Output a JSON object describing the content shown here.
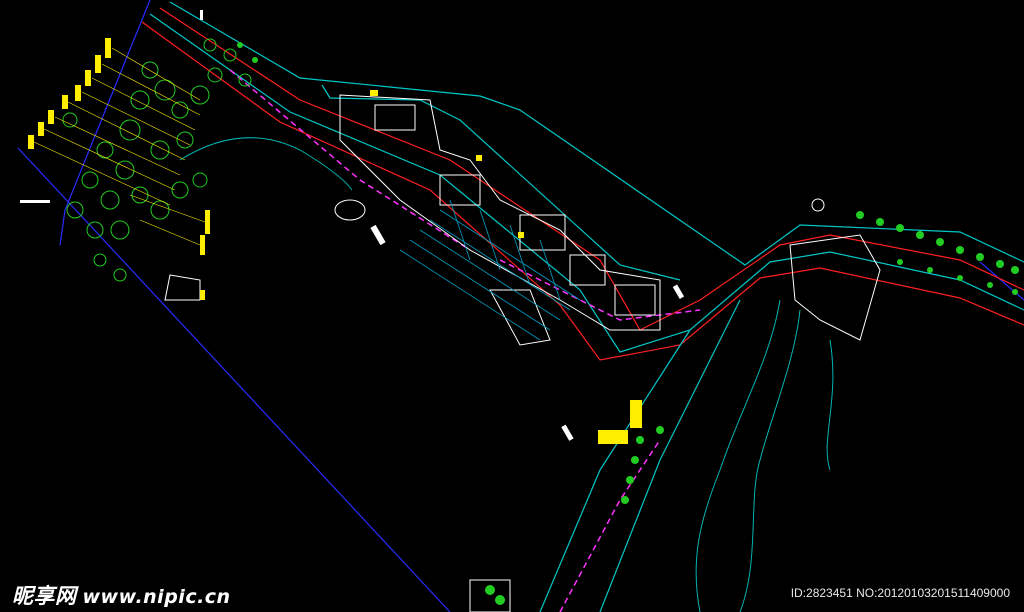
{
  "watermark": {
    "brand_cn": "昵享网",
    "brand_url": "www.nipic.cn",
    "image_id": "ID:2823451 NO:20120103201511409000"
  },
  "colors": {
    "background": "#000000",
    "road": "#ff2020",
    "curb": "#00c8c8",
    "boundary": "#2a2cff",
    "building": "#ffffff",
    "tree": "#22cc22",
    "label": "#ffee00",
    "accent": "#ff33ff"
  }
}
